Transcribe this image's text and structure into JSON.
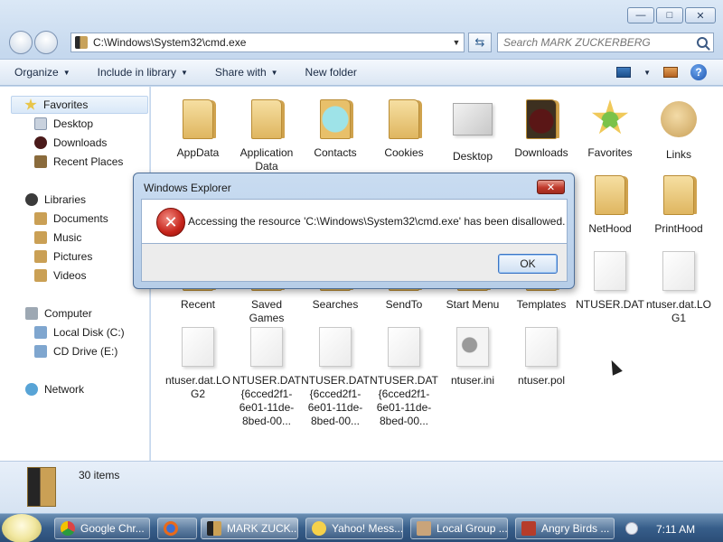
{
  "window": {
    "address_path": "C:\\Windows\\System32\\cmd.exe",
    "search_placeholder": "Search MARK ZUCKERBERG"
  },
  "toolbar": {
    "organize": "Organize",
    "include_in_library": "Include in library",
    "share_with": "Share with",
    "new_folder": "New folder"
  },
  "navpane": {
    "favorites": "Favorites",
    "desktop": "Desktop",
    "downloads": "Downloads",
    "recent_places": "Recent Places",
    "libraries": "Libraries",
    "documents": "Documents",
    "music": "Music",
    "pictures": "Pictures",
    "videos": "Videos",
    "computer": "Computer",
    "local_disk": "Local Disk (C:)",
    "cd_drive": "CD Drive (E:)",
    "network": "Network"
  },
  "items": [
    {
      "label": "AppData",
      "icon": "folder-icon"
    },
    {
      "label": "Application Data",
      "icon": "folder-shortcut-icon"
    },
    {
      "label": "Contacts",
      "icon": "contacts-folder-icon"
    },
    {
      "label": "Cookies",
      "icon": "folder-shortcut-icon"
    },
    {
      "label": "Desktop",
      "icon": "desktop-folder-icon"
    },
    {
      "label": "Downloads",
      "icon": "downloads-folder-icon"
    },
    {
      "label": "Favorites",
      "icon": "favorites-folder-icon"
    },
    {
      "label": "Links",
      "icon": "links-folder-icon"
    },
    {
      "label": "NetHood",
      "icon": "folder-shortcut-icon"
    },
    {
      "label": "PrintHood",
      "icon": "folder-shortcut-icon"
    },
    {
      "label": "Recent",
      "icon": "folder-shortcut-icon"
    },
    {
      "label": "Saved Games",
      "icon": "saved-games-folder-icon"
    },
    {
      "label": "Searches",
      "icon": "searches-folder-icon"
    },
    {
      "label": "SendTo",
      "icon": "folder-shortcut-icon"
    },
    {
      "label": "Start Menu",
      "icon": "folder-shortcut-icon"
    },
    {
      "label": "Templates",
      "icon": "folder-shortcut-icon"
    },
    {
      "label": "NTUSER.DAT",
      "icon": "file-icon"
    },
    {
      "label": "ntuser.dat.LOG1",
      "icon": "file-icon"
    },
    {
      "label": "ntuser.dat.LOG2",
      "icon": "file-icon"
    },
    {
      "label": "NTUSER.DAT{6cced2f1-6e01-11de-8bed-00...",
      "icon": "file-icon"
    },
    {
      "label": "NTUSER.DAT{6cced2f1-6e01-11de-8bed-00...",
      "icon": "file-icon"
    },
    {
      "label": "NTUSER.DAT{6cced2f1-6e01-11de-8bed-00...",
      "icon": "file-icon"
    },
    {
      "label": "ntuser.ini",
      "icon": "settings-file-icon"
    },
    {
      "label": "ntuser.pol",
      "icon": "file-icon"
    }
  ],
  "status": {
    "count": "30 items"
  },
  "dialog": {
    "title": "Windows Explorer",
    "message": "Accessing the resource 'C:\\Windows\\System32\\cmd.exe' has been disallowed.",
    "ok": "OK"
  },
  "taskbar": {
    "chrome": "Google Chr...",
    "explorer": "MARK ZUCK...",
    "yahoo": "Yahoo! Mess...",
    "localgroup": "Local Group ...",
    "angrybirds": "Angry Birds ...",
    "clock": "7:11 AM"
  }
}
